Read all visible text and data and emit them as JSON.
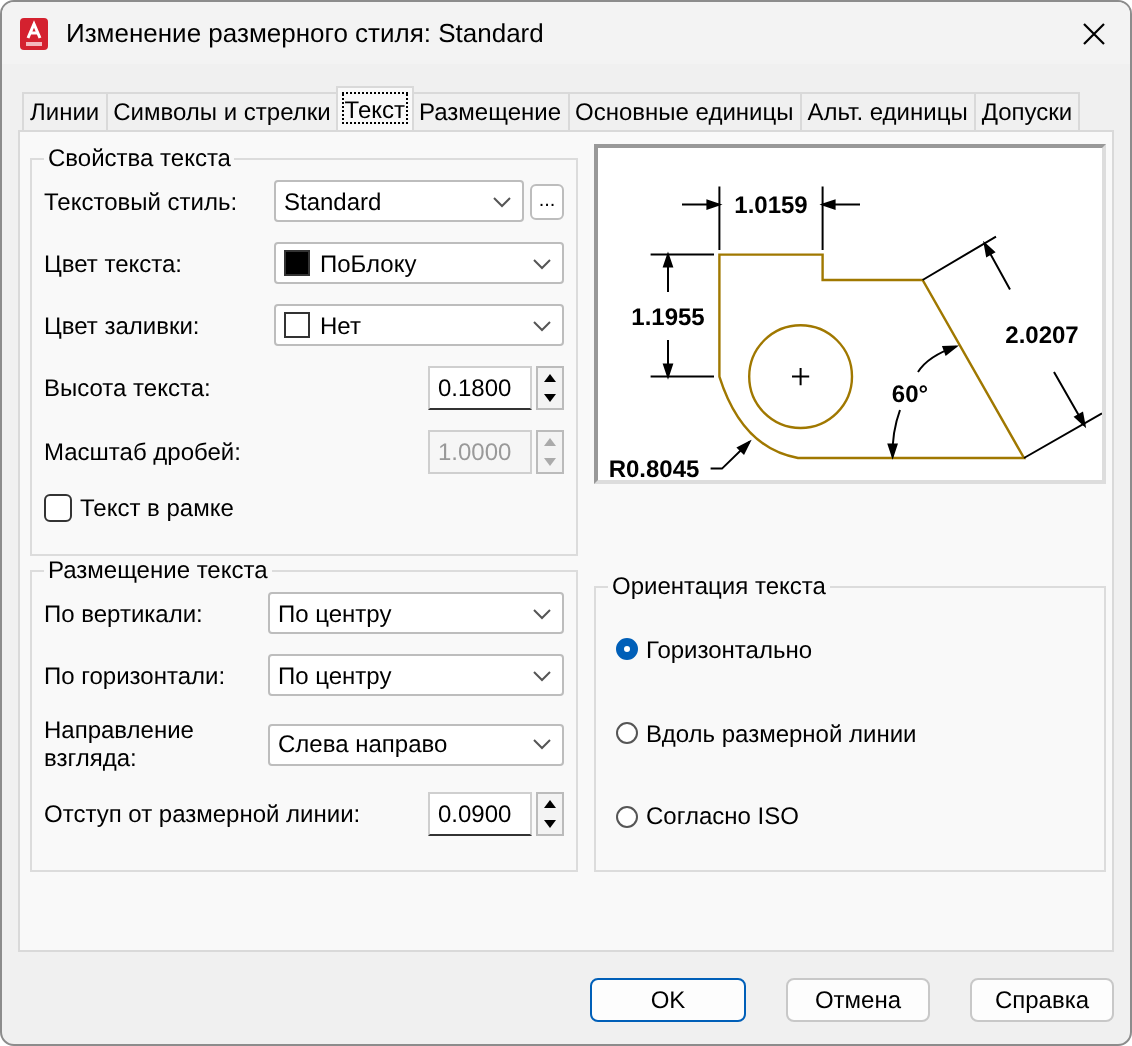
{
  "window": {
    "title": "Изменение размерного стиля: Standard"
  },
  "tabs": [
    {
      "label": "Линии",
      "selected": false
    },
    {
      "label": "Символы и стрелки",
      "selected": false
    },
    {
      "label": "Текст",
      "selected": true
    },
    {
      "label": "Размещение",
      "selected": false
    },
    {
      "label": "Основные единицы",
      "selected": false
    },
    {
      "label": "Альт. единицы",
      "selected": false
    },
    {
      "label": "Допуски",
      "selected": false
    }
  ],
  "text_properties": {
    "title": "Свойства текста",
    "fields": [
      {
        "kind": "combo",
        "label": "Текстовый стиль:",
        "value": "Standard",
        "browse_button": "..."
      },
      {
        "kind": "combo",
        "label": "Цвет текста:",
        "value": "ПоБлоку",
        "color": "#000000"
      },
      {
        "kind": "combo",
        "label": "Цвет заливки:",
        "value": "Нет",
        "color": "#ffffff"
      },
      {
        "kind": "spinner",
        "label": "Высота текста:",
        "value": "0.1800",
        "disabled": false
      },
      {
        "kind": "spinner",
        "label": "Масштаб дробей:",
        "value": "1.0000",
        "disabled": true
      },
      {
        "kind": "checkbox",
        "label": "Текст в рамке",
        "checked": false
      }
    ]
  },
  "preview": {
    "labels": [
      "1.0159",
      "1.1955",
      "2.0207",
      "60°",
      "R0.8045"
    ]
  },
  "text_placement": {
    "title": "Размещение текста",
    "fields": [
      {
        "kind": "combo",
        "label": "По вертикали:",
        "value": "По центру"
      },
      {
        "kind": "combo",
        "label": "По горизонтали:",
        "value": "По центру"
      },
      {
        "kind": "combo",
        "label": "Направление взгляда:",
        "value": "Слева направо"
      },
      {
        "kind": "spinner",
        "label": "Отступ от размерной линии:",
        "value": "0.0900",
        "disabled": false
      }
    ]
  },
  "text_orientation": {
    "title": "Ориентация текста",
    "options": [
      {
        "label": "Горизонтально",
        "selected": true
      },
      {
        "label": "Вдоль размерной линии",
        "selected": false
      },
      {
        "label": "Согласно ISO",
        "selected": false
      }
    ]
  },
  "buttons": [
    {
      "label": "OK",
      "default": true
    },
    {
      "label": "Отмена",
      "default": false
    },
    {
      "label": "Справка",
      "default": false
    }
  ]
}
